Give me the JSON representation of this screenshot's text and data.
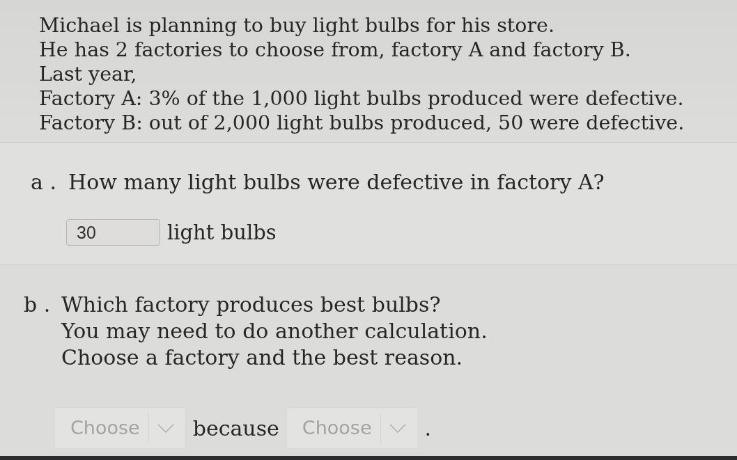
{
  "intro": [
    "Michael is planning to buy light bulbs for his store.",
    "He has 2 factories to choose from, factory A and factory B.",
    "Last year,",
    "Factory A: 3% of the 1,000 light bulbs produced were defective.",
    "Factory B: out of 2,000 light bulbs produced, 50 were defective."
  ],
  "questions": [
    {
      "kind": "numeric",
      "label": "a .",
      "prompt": [
        "How many light bulbs were defective in factory A?"
      ],
      "answer": {
        "value": "30",
        "unit": "light bulbs"
      }
    },
    {
      "kind": "choice",
      "label": "b .",
      "prompt": [
        "Which factory produces best bulbs?",
        "You may need to do another calculation.",
        "Choose a factory and the best reason."
      ],
      "answer": {
        "selects": [
          {
            "placeholder": "Choose"
          },
          {
            "placeholder": "Choose"
          }
        ],
        "connector": "because",
        "end": "."
      }
    }
  ]
}
